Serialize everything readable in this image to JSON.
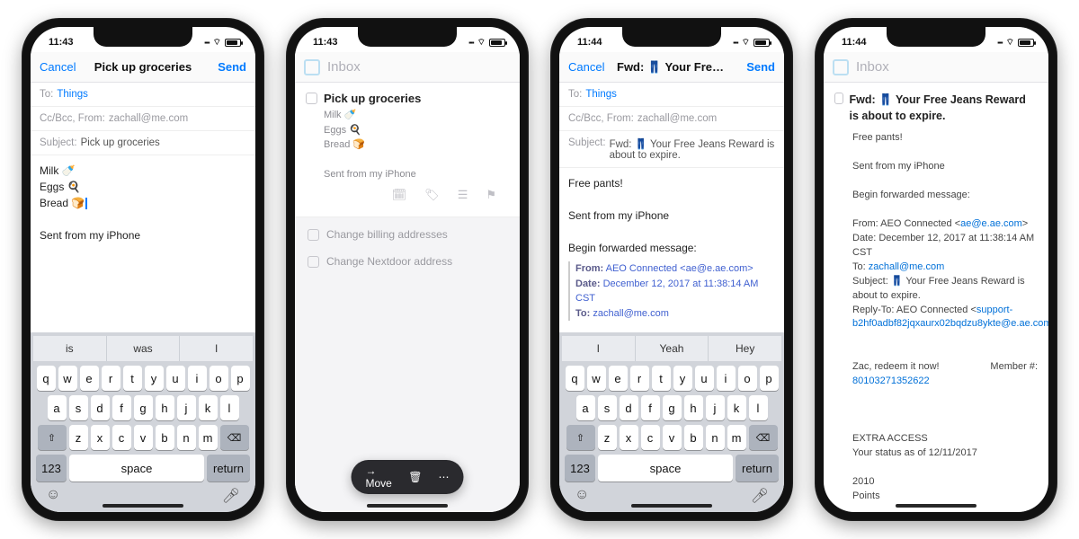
{
  "phone1": {
    "time": "11:43",
    "cancel": "Cancel",
    "title": "Pick up groceries",
    "send": "Send",
    "to_label": "To:",
    "to_value": "Things",
    "cc_label": "Cc/Bcc, From:",
    "cc_value": "zachall@me.com",
    "subject_label": "Subject:",
    "subject_value": "Pick up groceries",
    "body_l1": "Milk 🍼",
    "body_l2": "Eggs 🍳",
    "body_l3": "Bread 🍞",
    "signature": "Sent from my iPhone",
    "sug1": "is",
    "sug2": "was",
    "sug3": "I",
    "k123": "123",
    "kspace": "space",
    "kreturn": "return"
  },
  "phone2": {
    "time": "11:43",
    "inbox": "Inbox",
    "task_title": "Pick up groceries",
    "task_body": "Milk 🍼\nEggs 🍳\nBread 🍞\n\nSent from my iPhone",
    "other1": "Change billing addresses",
    "other2": "Change Nextdoor address",
    "move": "Move"
  },
  "phone3": {
    "time": "11:44",
    "cancel": "Cancel",
    "title": "Fwd: 👖 Your Free Jeans R…",
    "send": "Send",
    "to_label": "To:",
    "to_value": "Things",
    "cc_label": "Cc/Bcc, From:",
    "cc_value": "zachall@me.com",
    "subject_label": "Subject:",
    "subject_value": "Fwd: 👖 Your Free Jeans Reward is about to expire.",
    "body_l1": "Free pants!",
    "signature": "Sent from my iPhone",
    "begin_fwd": "Begin forwarded message:",
    "fwd_from_k": "From:",
    "fwd_from_v": "AEO Connected <ae@e.ae.com>",
    "fwd_date_k": "Date:",
    "fwd_date_v": "December 12, 2017 at 11:38:14 AM CST",
    "fwd_to_k": "To:",
    "fwd_to_v": "zachall@me.com",
    "sug1": "I",
    "sug2": "Yeah",
    "sug3": "Hey",
    "k123": "123",
    "kspace": "space",
    "kreturn": "return"
  },
  "phone4": {
    "time": "11:44",
    "inbox": "Inbox",
    "task_title": "Fwd: 👖 Your Free Jeans Reward is about to expire.",
    "l_free": "Free pants!",
    "l_sig": "Sent from my iPhone",
    "l_begin": "Begin forwarded message:",
    "from_label": "From: AEO Connected <",
    "from_link": "ae@e.ae.com",
    "from_end": ">",
    "date_line": "Date: December 12, 2017 at 11:38:14 AM CST",
    "to_label": "To: ",
    "to_link": "zachall@me.com",
    "subj_line": "Subject: 👖 Your Free Jeans Reward is about to expire.",
    "reply_label": "Reply-To: AEO Connected <",
    "reply_link": "support-b2hf0adbf82jqxaurx02bqdzu8ykte@e.ae.com",
    "reply_end": ">",
    "redeem": "Zac, redeem it now!",
    "member": "Member #:",
    "member_num": "80103271352622",
    "extra": "EXTRA ACCESS",
    "status": "Your status as of 12/11/2017",
    "points_num": "2010",
    "points_lbl": "Points"
  },
  "keys_r1": [
    "q",
    "w",
    "e",
    "r",
    "t",
    "y",
    "u",
    "i",
    "o",
    "p"
  ],
  "keys_r2": [
    "a",
    "s",
    "d",
    "f",
    "g",
    "h",
    "j",
    "k",
    "l"
  ],
  "keys_r3": [
    "z",
    "x",
    "c",
    "v",
    "b",
    "n",
    "m"
  ]
}
